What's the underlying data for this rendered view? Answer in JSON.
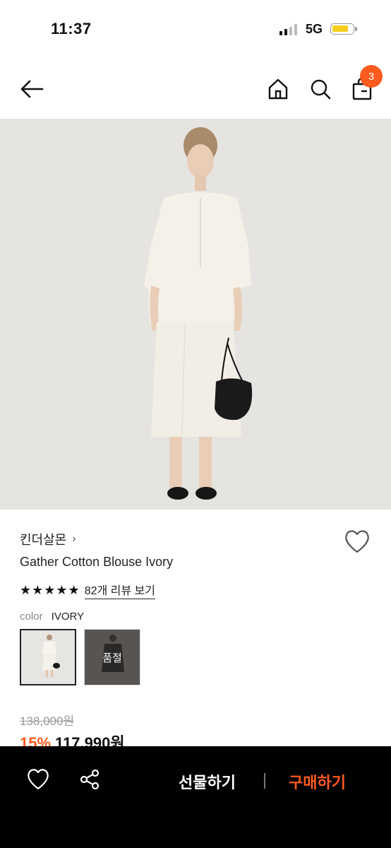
{
  "status_bar": {
    "time": "11:37",
    "network": "5G"
  },
  "nav": {
    "cart_count": "3"
  },
  "product": {
    "brand": "킨더살몬",
    "brand_chevron": "›",
    "title": "Gather Cotton Blouse Ivory",
    "stars": "★★★★★",
    "review_link": "82개 리뷰 보기",
    "color_label": "color",
    "color_value": "IVORY",
    "sold_out_label": "품절",
    "original_price": "138,000원",
    "discount": "15%",
    "sale_price": "117,990원"
  },
  "bottom_bar": {
    "gift_label": "선물하기",
    "buy_label": "구매하기"
  },
  "colors": {
    "accent": "#ff5a1f",
    "battery": "#f6cd1c",
    "bar_bg": "#000000"
  }
}
